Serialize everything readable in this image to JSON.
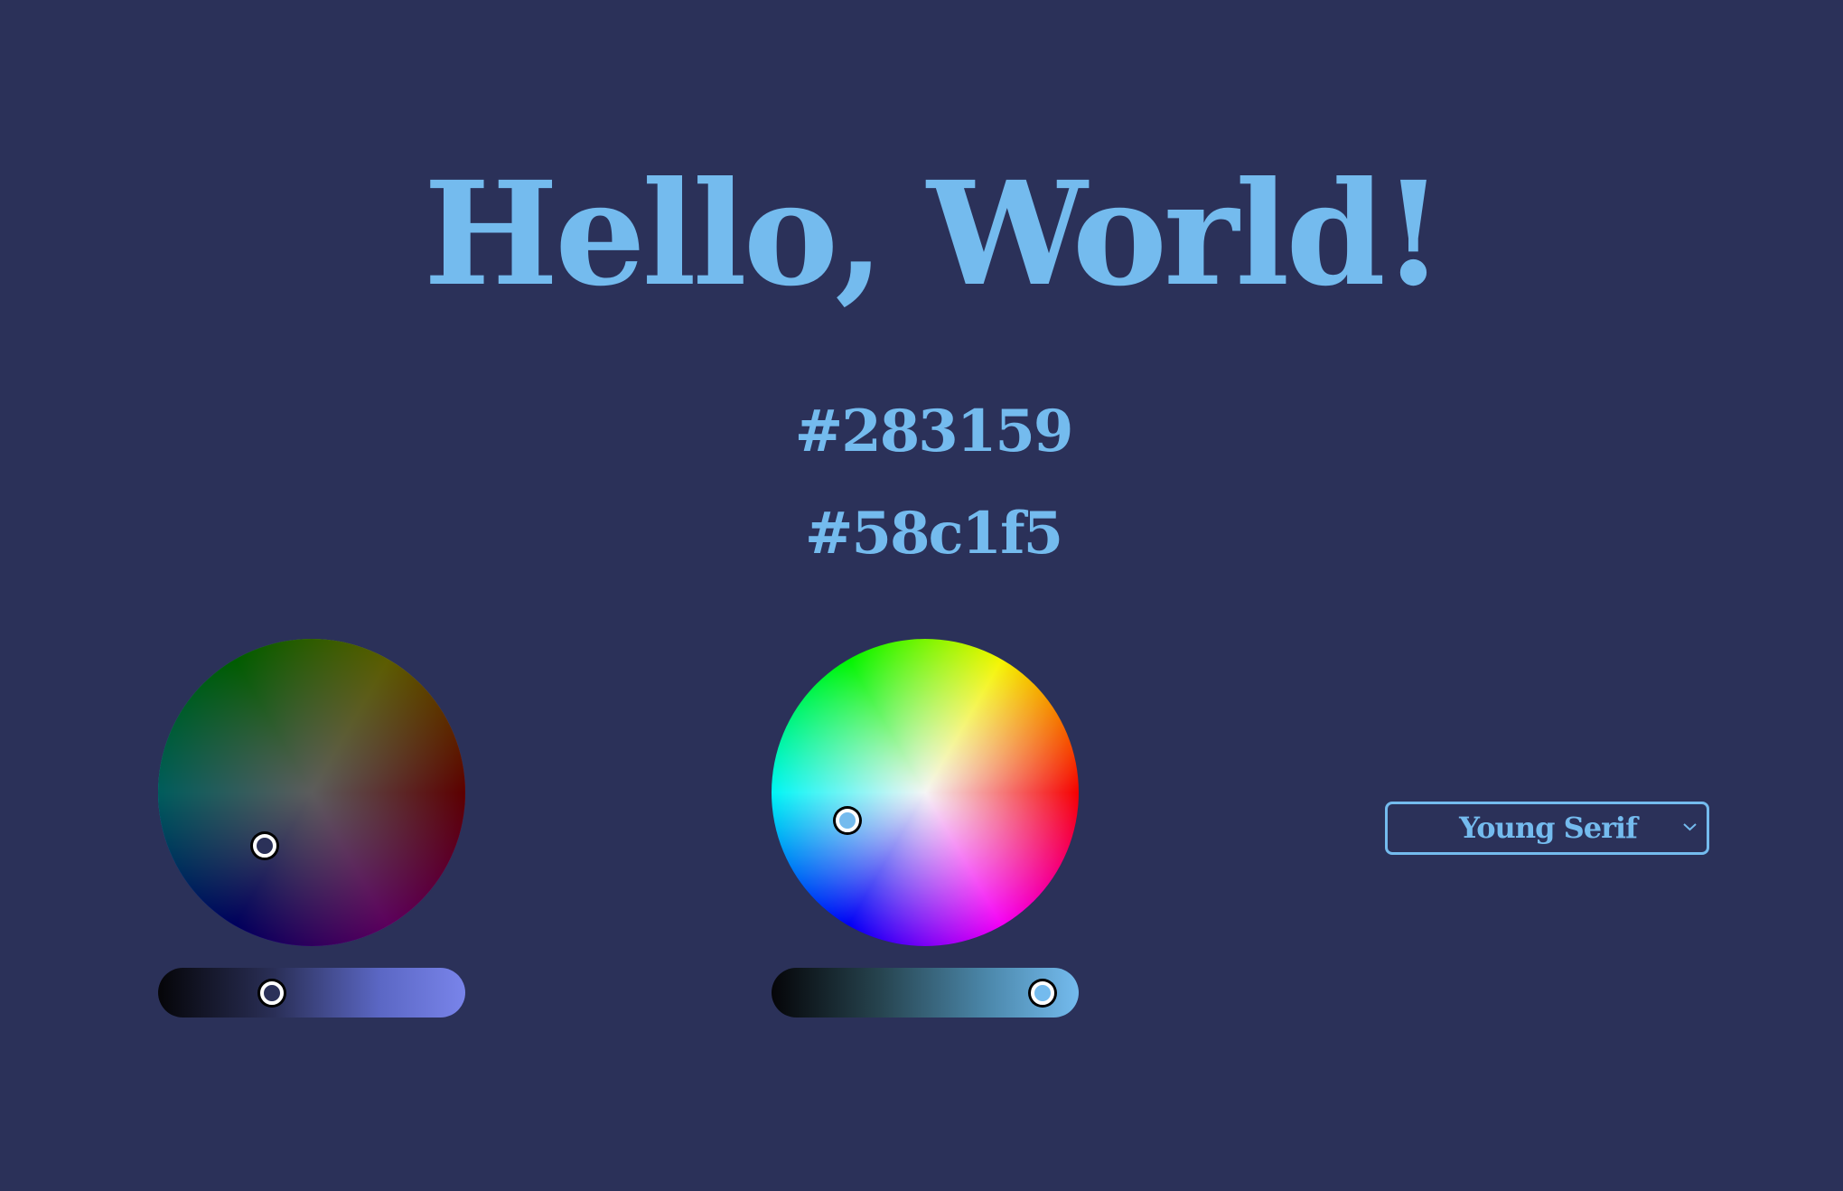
{
  "heading": "Hello, World!",
  "background_hex": "#283159",
  "foreground_hex": "#58c1f5",
  "colors": {
    "background": "#2b3159",
    "foreground": "#74bbee"
  },
  "font_select": {
    "selected": "Young Serif",
    "icon": "chevron-down-icon"
  }
}
